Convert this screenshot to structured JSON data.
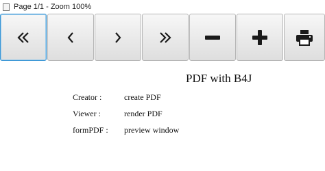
{
  "window": {
    "title": "Page 1/1 - Zoom 100%"
  },
  "toolbar": {
    "buttons": [
      {
        "name": "first-page",
        "icon": "double-chevron-left-icon"
      },
      {
        "name": "previous-page",
        "icon": "chevron-left-icon"
      },
      {
        "name": "next-page",
        "icon": "chevron-right-icon"
      },
      {
        "name": "last-page",
        "icon": "double-chevron-right-icon"
      },
      {
        "name": "zoom-out",
        "icon": "minus-icon"
      },
      {
        "name": "zoom-in",
        "icon": "plus-icon"
      },
      {
        "name": "print",
        "icon": "printer-icon"
      }
    ]
  },
  "document": {
    "title": "PDF with B4J",
    "rows": [
      {
        "label": "Creator :",
        "value": "create PDF"
      },
      {
        "label": "Viewer :",
        "value": "render PDF"
      },
      {
        "label": "formPDF :",
        "value": "preview window"
      }
    ]
  },
  "colors": {
    "focus_border": "#3c97d6",
    "icon": "#1a1a1a"
  }
}
